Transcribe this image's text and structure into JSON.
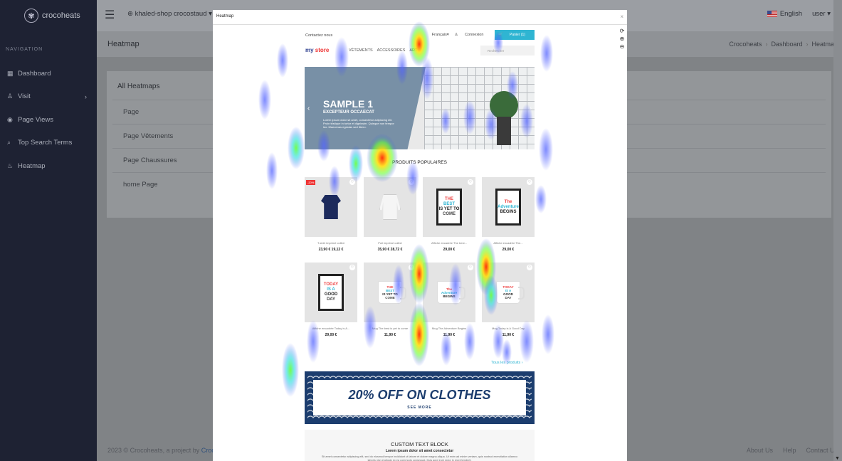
{
  "sidebar": {
    "brand": "crocoheats",
    "nav_heading": "NAVIGATION",
    "items": [
      {
        "icon": "grid-icon",
        "glyph": "▦",
        "label": "Dashboard"
      },
      {
        "icon": "user-icon",
        "glyph": "♙",
        "label": "Visit",
        "has_submenu": true
      },
      {
        "icon": "eye-icon",
        "glyph": "◉",
        "label": "Page Views"
      },
      {
        "icon": "search-icon",
        "glyph": "⌕",
        "label": "Top Search Terms"
      },
      {
        "icon": "fire-icon",
        "glyph": "♨",
        "label": "Heatmap"
      }
    ]
  },
  "topbar": {
    "shop": "khaled-shop crocostaud ▾",
    "language": "English",
    "user": "user ▾"
  },
  "page": {
    "title": "Heatmap",
    "breadcrumbs": [
      "Crocoheats",
      "Dashboard",
      "Heatmap"
    ]
  },
  "card": {
    "title": "All Heatmaps",
    "rows": [
      "Page",
      "Page Vêtements",
      "Page Chaussures",
      "home Page"
    ]
  },
  "footer": {
    "copyright": "2023 © Crocoheats, a project by ",
    "brand_link": "Croco",
    "links": [
      "About Us",
      "Help",
      "Contact Us"
    ]
  },
  "modal": {
    "title": "Heatmap",
    "close": "×",
    "tools": [
      "⟳",
      "⊕",
      "⊖"
    ]
  },
  "site": {
    "contact": "Contactez nous",
    "lang": "Français▾",
    "login": "Connexion",
    "cart": "Panier (1)",
    "logo_a": "my",
    "logo_b": " store",
    "menu": [
      "VÊTEMENTS",
      "ACCESSOIRES",
      "ART"
    ],
    "search_placeholder": "Rechercher",
    "slide": {
      "title": "SAMPLE 1",
      "subtitle": "EXCEPTEUR OCCAECAT",
      "text": "Lorem ipsum dolor sit amet, consectetur adipiscing elit. Proin tristique in tortor et dignissim. Quisque non tempor leo. Maecenas egestas sed libero."
    },
    "popular": "PRODUITS POPULAIRES",
    "products": [
      {
        "name": "T-shirt imprimé colibri",
        "price": "23,90 € 19,12 €",
        "badge": "-20%",
        "art": "tshirt",
        "lines": []
      },
      {
        "name": "Pull imprimé colibri",
        "price": "35,90 € 28,72 €",
        "art": "sweat",
        "lines": []
      },
      {
        "name": "Affiche encadrée The best...",
        "price": "29,00 €",
        "art": "frame",
        "lines": [
          "THE",
          "BEST",
          "IS YET TO",
          "COME"
        ]
      },
      {
        "name": "Affiche encadrée The...",
        "price": "29,00 €",
        "art": "frame",
        "lines": [
          "The",
          "Adventure",
          "BEGINS"
        ]
      },
      {
        "name": "Affiche encadrée Today is A...",
        "price": "29,00 €",
        "art": "frame",
        "lines": [
          "TODAY",
          "IS A",
          "GOOD",
          "DAY"
        ]
      },
      {
        "name": "Mug The best is yet to come",
        "price": "11,90 €",
        "art": "mug",
        "lines": [
          "THE",
          "BEST",
          "IS YET TO",
          "COME"
        ]
      },
      {
        "name": "Mug The Adventure Begins",
        "price": "11,90 €",
        "art": "mug",
        "lines": [
          "The",
          "Adventure",
          "BEGINS"
        ]
      },
      {
        "name": "Mug Today is A Good Day",
        "price": "11,90 €",
        "art": "mug",
        "lines": [
          "TODAY",
          "IS A",
          "GOOD",
          "DAY"
        ]
      }
    ],
    "all_products": "Tous les produits ›",
    "banner": {
      "headline": "20% OFF ON CLOTHES",
      "cta": "SEE MORE"
    },
    "custom_block": {
      "title": "CUSTOM TEXT BLOCK",
      "subtitle": "Lorem ipsum dolor sit amet consectetur",
      "body": "Sit amet consectetur adipiscing elit, sed do eiusmod tempor incididunt ut labore et dolore magna aliqua. Ut enim ad minim veniam, quis nostrud exercitation ullamco laboris nisi ut aliquip ex ea commodo consequat. Duis aute irure dolor in reprehenderit."
    }
  },
  "colors": {
    "hot": "#ff2a00",
    "warm": "#ffdd00",
    "mid": "#66ff33",
    "cool": "#3344ff"
  }
}
